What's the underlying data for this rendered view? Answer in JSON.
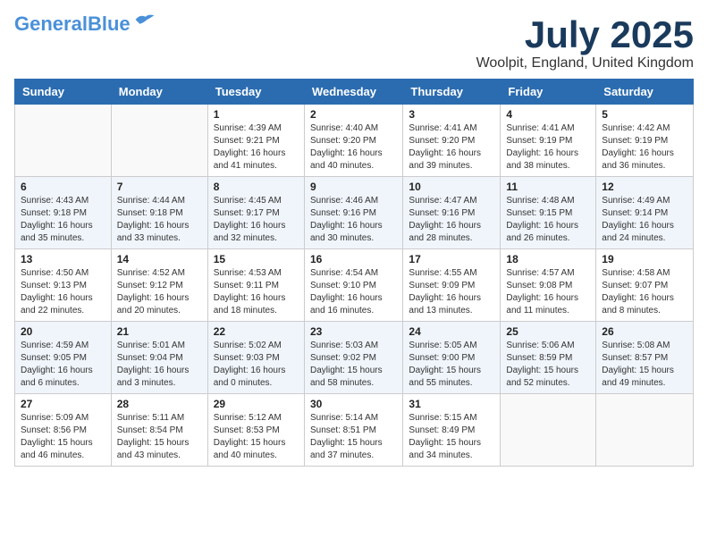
{
  "header": {
    "logo_line1": "General",
    "logo_line2": "Blue",
    "month": "July 2025",
    "location": "Woolpit, England, United Kingdom"
  },
  "days_of_week": [
    "Sunday",
    "Monday",
    "Tuesday",
    "Wednesday",
    "Thursday",
    "Friday",
    "Saturday"
  ],
  "weeks": [
    [
      {
        "day": "",
        "info": ""
      },
      {
        "day": "",
        "info": ""
      },
      {
        "day": "1",
        "info": "Sunrise: 4:39 AM\nSunset: 9:21 PM\nDaylight: 16 hours and 41 minutes."
      },
      {
        "day": "2",
        "info": "Sunrise: 4:40 AM\nSunset: 9:20 PM\nDaylight: 16 hours and 40 minutes."
      },
      {
        "day": "3",
        "info": "Sunrise: 4:41 AM\nSunset: 9:20 PM\nDaylight: 16 hours and 39 minutes."
      },
      {
        "day": "4",
        "info": "Sunrise: 4:41 AM\nSunset: 9:19 PM\nDaylight: 16 hours and 38 minutes."
      },
      {
        "day": "5",
        "info": "Sunrise: 4:42 AM\nSunset: 9:19 PM\nDaylight: 16 hours and 36 minutes."
      }
    ],
    [
      {
        "day": "6",
        "info": "Sunrise: 4:43 AM\nSunset: 9:18 PM\nDaylight: 16 hours and 35 minutes."
      },
      {
        "day": "7",
        "info": "Sunrise: 4:44 AM\nSunset: 9:18 PM\nDaylight: 16 hours and 33 minutes."
      },
      {
        "day": "8",
        "info": "Sunrise: 4:45 AM\nSunset: 9:17 PM\nDaylight: 16 hours and 32 minutes."
      },
      {
        "day": "9",
        "info": "Sunrise: 4:46 AM\nSunset: 9:16 PM\nDaylight: 16 hours and 30 minutes."
      },
      {
        "day": "10",
        "info": "Sunrise: 4:47 AM\nSunset: 9:16 PM\nDaylight: 16 hours and 28 minutes."
      },
      {
        "day": "11",
        "info": "Sunrise: 4:48 AM\nSunset: 9:15 PM\nDaylight: 16 hours and 26 minutes."
      },
      {
        "day": "12",
        "info": "Sunrise: 4:49 AM\nSunset: 9:14 PM\nDaylight: 16 hours and 24 minutes."
      }
    ],
    [
      {
        "day": "13",
        "info": "Sunrise: 4:50 AM\nSunset: 9:13 PM\nDaylight: 16 hours and 22 minutes."
      },
      {
        "day": "14",
        "info": "Sunrise: 4:52 AM\nSunset: 9:12 PM\nDaylight: 16 hours and 20 minutes."
      },
      {
        "day": "15",
        "info": "Sunrise: 4:53 AM\nSunset: 9:11 PM\nDaylight: 16 hours and 18 minutes."
      },
      {
        "day": "16",
        "info": "Sunrise: 4:54 AM\nSunset: 9:10 PM\nDaylight: 16 hours and 16 minutes."
      },
      {
        "day": "17",
        "info": "Sunrise: 4:55 AM\nSunset: 9:09 PM\nDaylight: 16 hours and 13 minutes."
      },
      {
        "day": "18",
        "info": "Sunrise: 4:57 AM\nSunset: 9:08 PM\nDaylight: 16 hours and 11 minutes."
      },
      {
        "day": "19",
        "info": "Sunrise: 4:58 AM\nSunset: 9:07 PM\nDaylight: 16 hours and 8 minutes."
      }
    ],
    [
      {
        "day": "20",
        "info": "Sunrise: 4:59 AM\nSunset: 9:05 PM\nDaylight: 16 hours and 6 minutes."
      },
      {
        "day": "21",
        "info": "Sunrise: 5:01 AM\nSunset: 9:04 PM\nDaylight: 16 hours and 3 minutes."
      },
      {
        "day": "22",
        "info": "Sunrise: 5:02 AM\nSunset: 9:03 PM\nDaylight: 16 hours and 0 minutes."
      },
      {
        "day": "23",
        "info": "Sunrise: 5:03 AM\nSunset: 9:02 PM\nDaylight: 15 hours and 58 minutes."
      },
      {
        "day": "24",
        "info": "Sunrise: 5:05 AM\nSunset: 9:00 PM\nDaylight: 15 hours and 55 minutes."
      },
      {
        "day": "25",
        "info": "Sunrise: 5:06 AM\nSunset: 8:59 PM\nDaylight: 15 hours and 52 minutes."
      },
      {
        "day": "26",
        "info": "Sunrise: 5:08 AM\nSunset: 8:57 PM\nDaylight: 15 hours and 49 minutes."
      }
    ],
    [
      {
        "day": "27",
        "info": "Sunrise: 5:09 AM\nSunset: 8:56 PM\nDaylight: 15 hours and 46 minutes."
      },
      {
        "day": "28",
        "info": "Sunrise: 5:11 AM\nSunset: 8:54 PM\nDaylight: 15 hours and 43 minutes."
      },
      {
        "day": "29",
        "info": "Sunrise: 5:12 AM\nSunset: 8:53 PM\nDaylight: 15 hours and 40 minutes."
      },
      {
        "day": "30",
        "info": "Sunrise: 5:14 AM\nSunset: 8:51 PM\nDaylight: 15 hours and 37 minutes."
      },
      {
        "day": "31",
        "info": "Sunrise: 5:15 AM\nSunset: 8:49 PM\nDaylight: 15 hours and 34 minutes."
      },
      {
        "day": "",
        "info": ""
      },
      {
        "day": "",
        "info": ""
      }
    ]
  ]
}
